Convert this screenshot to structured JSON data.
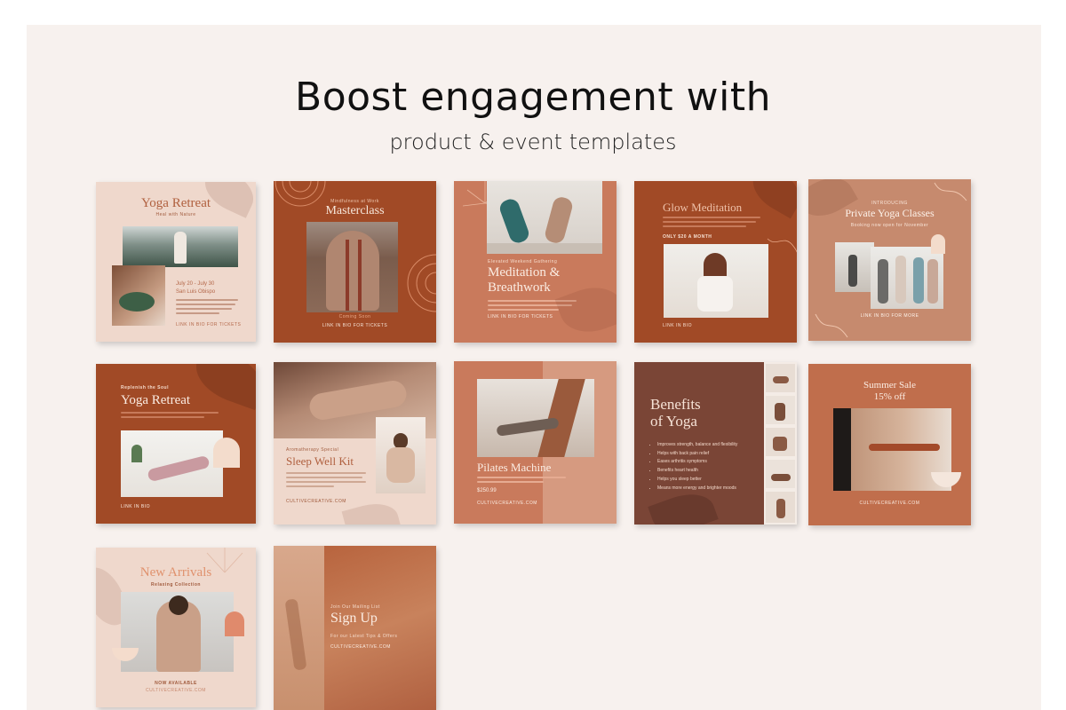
{
  "heading": {
    "title": "Boost engagement with",
    "subtitle": "product & event templates"
  },
  "colors": {
    "background": "#f7f1ee",
    "rust": "#a14a26",
    "terracotta": "#c97a5c",
    "blush": "#efd8cc",
    "clay": "#c68a6e",
    "brown": "#7a4536",
    "cream": "#f4e6dc"
  },
  "cards": {
    "yoga_retreat_1": {
      "title": "Yoga Retreat",
      "subtitle": "Heal with Nature",
      "dates": "July 20 - July 30",
      "location": "San Luis Obispo",
      "cta": "LINK IN BIO FOR TICKETS"
    },
    "masterclass": {
      "kicker": "Mindfulness at Work",
      "title": "Masterclass",
      "note": "Coming Soon",
      "cta": "LINK IN BIO FOR TICKETS"
    },
    "meditation": {
      "kicker": "Elevated Weekend Gathering",
      "title_line1": "Meditation &",
      "title_line2": "Breathwork",
      "cta": "LINK IN BIO FOR TICKETS"
    },
    "glow": {
      "title": "Glow Meditation",
      "price": "ONLY $20 A MONTH",
      "cta": "LINK IN BIO"
    },
    "private": {
      "kicker": "INTRODUCING",
      "title": "Private Yoga Classes",
      "note": "Booking now open for November",
      "cta": "LINK IN BIO FOR MORE"
    },
    "yoga_retreat_2": {
      "kicker": "Replenish the Soul",
      "title": "Yoga Retreat",
      "cta": "LINK IN BIO"
    },
    "sleep": {
      "kicker": "Aromatherapy Special",
      "title": "Sleep Well Kit",
      "cta": "CULTIVECREATIVE.COM"
    },
    "pilates": {
      "title": "Pilates Machine",
      "price": "$250.99",
      "cta": "CULTIVECREATIVE.COM"
    },
    "benefits": {
      "title_line1": "Benefits",
      "title_line2": "of Yoga",
      "items": [
        "Improves strength, balance and flexibility",
        "Helps with back pain relief",
        "Eases arthritis symptoms",
        "Benefits heart health",
        "Helps you sleep better",
        "Means more energy and brighter moods"
      ]
    },
    "summer": {
      "title": "Summer Sale",
      "discount": "15% off",
      "cta": "CULTIVECREATIVE.COM"
    },
    "arrivals": {
      "title": "New Arrivals",
      "subtitle": "Relaxing Collection",
      "note": "NOW AVAILABLE",
      "cta": "CULTIVECREATIVE.COM"
    },
    "signup": {
      "kicker": "Join Our Mailing List",
      "title": "Sign Up",
      "note": "For our Latest Tips & Offers",
      "cta": "CULTIVECREATIVE.COM"
    }
  }
}
